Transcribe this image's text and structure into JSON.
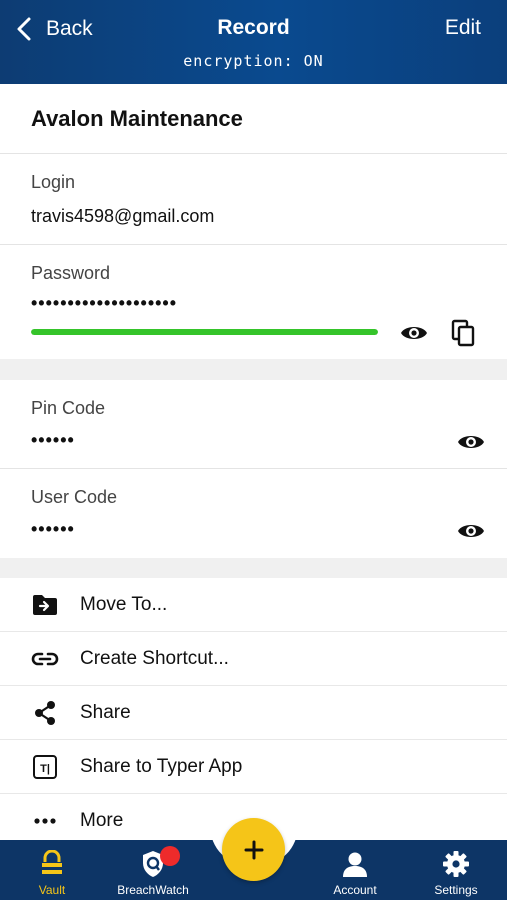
{
  "header": {
    "back_label": "Back",
    "title": "Record",
    "edit_label": "Edit",
    "encryption": "encryption: ON"
  },
  "record": {
    "name": "Avalon Maintenance"
  },
  "fields": {
    "login": {
      "label": "Login",
      "value": "travis4598@gmail.com"
    },
    "password": {
      "label": "Password",
      "masked": "••••••••••••••••••••",
      "strength": 1.0,
      "strength_color": "#35c42a"
    },
    "pin_code": {
      "label": "Pin Code",
      "masked": "••••••"
    },
    "user_code": {
      "label": "User Code",
      "masked": "••••••"
    }
  },
  "actions": [
    {
      "label": "Move To...",
      "icon": "folder-move-icon"
    },
    {
      "label": "Create Shortcut...",
      "icon": "link-icon"
    },
    {
      "label": "Share",
      "icon": "share-icon"
    },
    {
      "label": "Share to Typer App",
      "icon": "typer-app-icon"
    },
    {
      "label": "More",
      "icon": "more-dots-icon"
    }
  ],
  "bottom_nav": {
    "vault": "Vault",
    "breachwatch": "BreachWatch",
    "add": "+",
    "account": "Account",
    "settings": "Settings"
  },
  "colors": {
    "header": "#0a4a8f",
    "nav": "#0d3566",
    "accent": "#f5c518",
    "badge": "#ee2b2b"
  }
}
